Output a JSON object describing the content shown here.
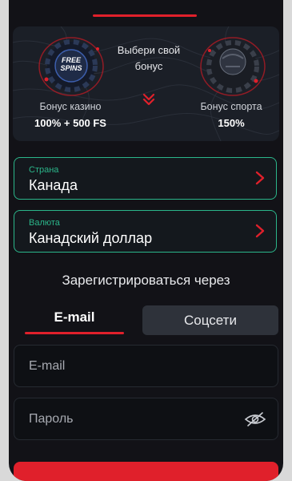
{
  "bonus": {
    "choose_label": "Выбери свой бонус",
    "casino": {
      "title": "Бонус казино",
      "value": "100% + 500 FS",
      "chip_text": "FREE SPINS"
    },
    "sport": {
      "title": "Бонус спорта",
      "value": "150%"
    }
  },
  "country": {
    "label": "Страна",
    "value": "Канада"
  },
  "currency": {
    "label": "Валюта",
    "value": "Канадский доллар"
  },
  "register_via": "Зарегистрироваться через",
  "tabs": {
    "email": "E-mail",
    "social": "Соцсети",
    "active": "email"
  },
  "form": {
    "email_placeholder": "E-mail",
    "password_placeholder": "Пароль"
  },
  "colors": {
    "accent": "#e0202b",
    "field_border": "#2bb68a",
    "background": "#121217"
  }
}
